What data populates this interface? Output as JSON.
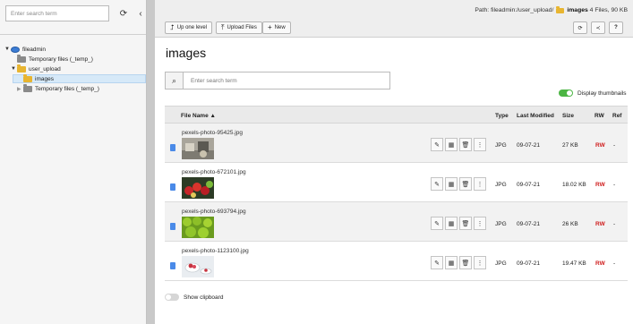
{
  "tree": {
    "search_placeholder": "Enter search term",
    "refresh_icon": "refresh-icon",
    "collapse_icon": "chevron-left-icon",
    "nodes": [
      {
        "label": "fileadmin",
        "icon": "globe-icon",
        "toggle": "▼"
      },
      {
        "label": "Temporary files (_temp_)",
        "icon": "folder-icon",
        "toggle": ""
      },
      {
        "label": "user_upload",
        "icon": "folder-icon",
        "toggle": "▼"
      },
      {
        "label": "images",
        "icon": "folder-icon",
        "toggle": ""
      },
      {
        "label": "Temporary files (_temp_)",
        "icon": "folder-icon",
        "toggle": "▶"
      }
    ]
  },
  "header": {
    "path_prefix": "Path: fileadmin:/user_upload/",
    "path_current": "images",
    "path_suffix": " 4 Files, 90 KB",
    "up_label": "Up one level",
    "upload_label": "Upload Files",
    "new_label": "New",
    "help_label": "?"
  },
  "main": {
    "title": "images",
    "search_placeholder": "Enter search term",
    "thumbnails_label": "Display thumbnails",
    "clipboard_label": "Show clipboard"
  },
  "table": {
    "columns": {
      "name": "File Name ▲",
      "type": "Type",
      "modified": "Last Modified",
      "size": "Size",
      "rw": "RW",
      "ref": "Ref"
    },
    "rows": [
      {
        "name": "pexels-photo-95425.jpg",
        "type": "JPG",
        "modified": "09-07-21",
        "size": "27 KB",
        "rw": "RW",
        "ref": "-"
      },
      {
        "name": "pexels-photo-672101.jpg",
        "type": "JPG",
        "modified": "09-07-21",
        "size": "18.02 KB",
        "rw": "RW",
        "ref": "-"
      },
      {
        "name": "pexels-photo-693794.jpg",
        "type": "JPG",
        "modified": "09-07-21",
        "size": "26 KB",
        "rw": "RW",
        "ref": "-"
      },
      {
        "name": "pexels-photo-1123100.jpg",
        "type": "JPG",
        "modified": "09-07-21",
        "size": "19.47 KB",
        "rw": "RW",
        "ref": "-"
      }
    ]
  },
  "colors": {
    "accent_rw": "#d02020",
    "toggle_on": "#4bb543",
    "folder": "#e8b530"
  }
}
